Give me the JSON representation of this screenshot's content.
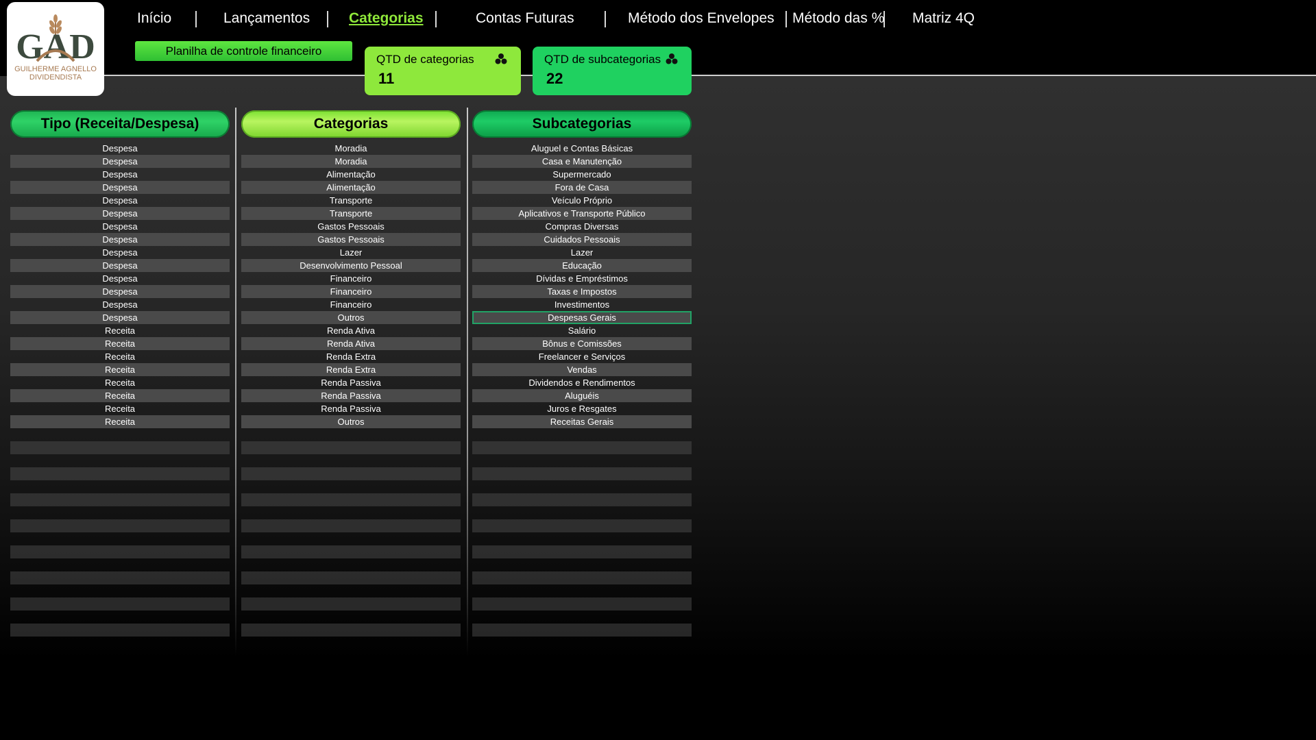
{
  "logo": {
    "mark": "GAD",
    "line1": "GUILHERME AGNELLO",
    "line2": "DIVIDENDISTA",
    "icon": "wheat-icon"
  },
  "nav": {
    "items": [
      "Início",
      "Lançamentos",
      "Categorias",
      "Contas Futuras",
      "Método dos Envelopes",
      "Método das %",
      "Matriz 4Q"
    ],
    "active": "Categorias"
  },
  "subtitle": "Planilha de controle financeiro",
  "kpis": [
    {
      "label": "QTD de categorias",
      "value": "11",
      "icon": "cluster-icon"
    },
    {
      "label": "QTD de subcategorias",
      "value": "22",
      "icon": "cluster-icon"
    }
  ],
  "colors": {
    "accent_lime": "#8ee83c",
    "accent_green": "#1fd160",
    "selection": "#21a366"
  },
  "columns": {
    "tipo": {
      "header": "Tipo (Receita/Despesa)",
      "values": [
        "Despesa",
        "Despesa",
        "Despesa",
        "Despesa",
        "Despesa",
        "Despesa",
        "Despesa",
        "Despesa",
        "Despesa",
        "Despesa",
        "Despesa",
        "Despesa",
        "Despesa",
        "Despesa",
        "Receita",
        "Receita",
        "Receita",
        "Receita",
        "Receita",
        "Receita",
        "Receita",
        "Receita"
      ]
    },
    "categorias": {
      "header": "Categorias",
      "values": [
        "Moradia",
        "Moradia",
        "Alimentação",
        "Alimentação",
        "Transporte",
        "Transporte",
        "Gastos Pessoais",
        "Gastos Pessoais",
        "Lazer",
        "Desenvolvimento Pessoal",
        "Financeiro",
        "Financeiro",
        "Financeiro",
        "Outros",
        "Renda Ativa",
        "Renda Ativa",
        "Renda Extra",
        "Renda Extra",
        "Renda Passiva",
        "Renda Passiva",
        "Renda Passiva",
        "Outros"
      ]
    },
    "subcategorias": {
      "header": "Subcategorias",
      "values": [
        "Aluguel e Contas Básicas",
        "Casa e Manutenção",
        "Supermercado",
        "Fora de Casa",
        "Veículo Próprio",
        "Aplicativos e Transporte Público",
        "Compras Diversas",
        "Cuidados Pessoais",
        "Lazer",
        "Educação",
        "Dívidas e Empréstimos",
        "Taxas e Impostos",
        "Investimentos",
        "Despesas Gerais",
        "Salário",
        "Bônus e Comissões",
        "Freelancer e Serviços",
        "Vendas",
        "Dividendos e Rendimentos",
        "Aluguéis",
        "Juros e Resgates",
        "Receitas Gerais"
      ],
      "selected_index": 13
    }
  }
}
